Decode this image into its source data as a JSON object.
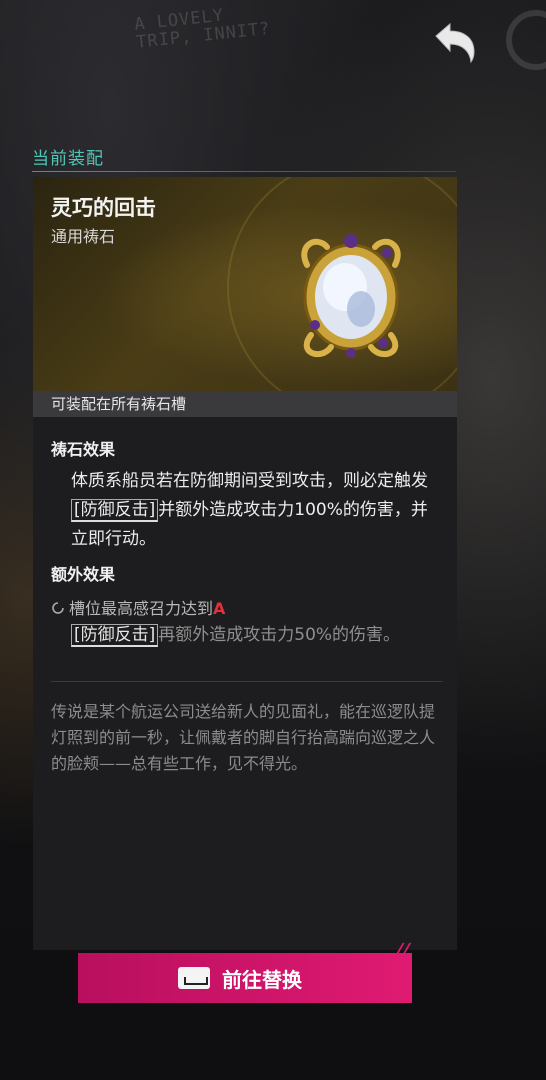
{
  "background": {
    "graffiti": "A LOVELY TRIP, INNIT?"
  },
  "header": {
    "back_icon": "back-arrow-icon"
  },
  "section": {
    "label": "当前装配"
  },
  "item": {
    "name": "灵巧的回击",
    "type": "通用祷石",
    "equip_hint": "可装配在所有祷石槽",
    "effect_heading": "祷石效果",
    "effect": {
      "prefix": "体质系船员若在防御期间受到攻击，则必定触发",
      "keyword": "[防御反击]",
      "suffix": "并额外造成攻击力100%的伤害，并立即行动。"
    },
    "extra_heading": "额外效果",
    "extra": {
      "condition": "槽位最高感召力达到",
      "grade": "A",
      "keyword": "[防御反击]",
      "text": "再额外造成攻击力50%的伤害。"
    },
    "lore": "传说是某个航运公司送给新人的见面礼，能在巡逻队提灯照到的前一秒，让佩戴者的脚自行抬高踹向巡逻之人的脸颊——总有些工作，见不得光。"
  },
  "action": {
    "goto_label": "前往替换",
    "key_icon": "space-key-icon"
  },
  "colors": {
    "accent_teal": "#4fc7b7",
    "button_pink": "#e01a72",
    "grade_red": "#e0323c"
  }
}
